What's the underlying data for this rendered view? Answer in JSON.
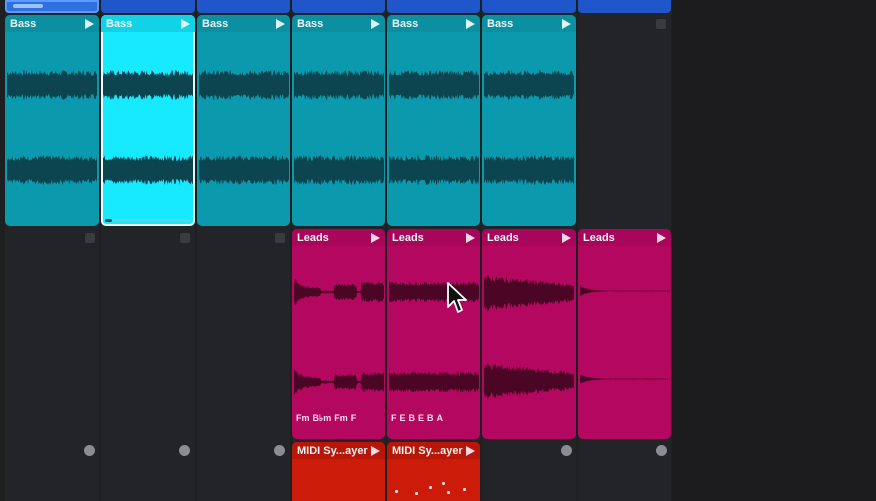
{
  "colors": {
    "bass": "#0a99ad",
    "bass_selected": "#17e9ff",
    "leads": "#b4075f",
    "midi": "#cc1b08",
    "background": "#1e1f21"
  },
  "icons": {
    "play": "play-icon",
    "stop": "stop-icon",
    "record": "record-icon",
    "cursor": "pointer-cursor-icon"
  },
  "bass_clips": [
    {
      "name": "Bass"
    },
    {
      "name": "Bass"
    },
    {
      "name": "Bass"
    },
    {
      "name": "Bass"
    },
    {
      "name": "Bass"
    },
    {
      "name": "Bass"
    }
  ],
  "selected_clip_progress": 0.08,
  "leads_clips": [
    {
      "name": "Leads",
      "chords": [
        "Fm",
        "B♭m",
        "Fm",
        "F"
      ]
    },
    {
      "name": "Leads",
      "chords": [
        "F",
        "E",
        "B",
        "E",
        "B",
        "A"
      ]
    },
    {
      "name": "Leads",
      "chords": []
    },
    {
      "name": "Leads",
      "chords": []
    }
  ],
  "midi_clips": [
    {
      "name": "MIDI Sy...ayer"
    },
    {
      "name": "MIDI Sy...ayer"
    }
  ]
}
